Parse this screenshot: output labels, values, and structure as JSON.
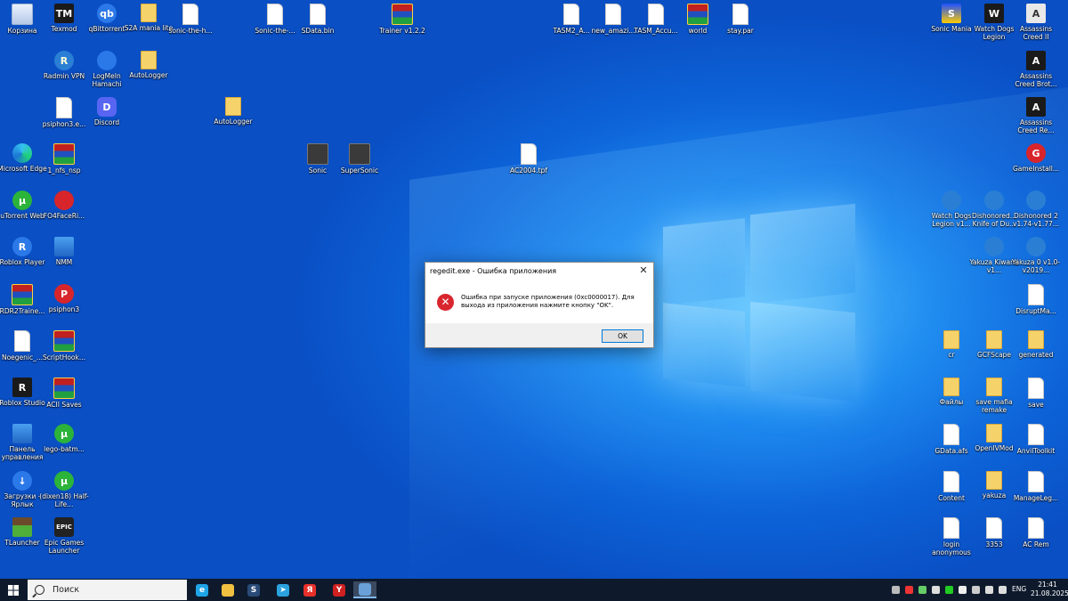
{
  "desktop_icons": [
    {
      "id": "recycle",
      "label": "Корзина",
      "glyph": "",
      "type": "t-recycle"
    },
    {
      "id": "texmod",
      "label": "Texmod",
      "glyph": "TM",
      "type": "t-dark"
    },
    {
      "id": "qbit",
      "label": "qBittorrent",
      "glyph": "qb",
      "type": "t-blue"
    },
    {
      "id": "s2a",
      "label": "S2A mania lite",
      "glyph": "",
      "type": "t-folder"
    },
    {
      "id": "sonic1",
      "label": "sonic-the-h...",
      "glyph": "",
      "type": "t-file"
    },
    {
      "id": "sonic2",
      "label": "Sonic-the-...",
      "glyph": "",
      "type": "t-file"
    },
    {
      "id": "sdata",
      "label": "SData.bin",
      "glyph": "",
      "type": "t-file"
    },
    {
      "id": "trainer",
      "label": "Trainer v1.2.2",
      "glyph": "",
      "type": "t-rar"
    },
    {
      "id": "tasm2",
      "label": "TASM2_A...",
      "glyph": "",
      "type": "t-file"
    },
    {
      "id": "newamaz",
      "label": "new_amazi...",
      "glyph": "",
      "type": "t-file"
    },
    {
      "id": "tasmacc",
      "label": "TASM_Accu...",
      "glyph": "",
      "type": "t-file"
    },
    {
      "id": "world",
      "label": "world",
      "glyph": "",
      "type": "t-rar"
    },
    {
      "id": "staypar",
      "label": "stay.par",
      "glyph": "",
      "type": "t-file"
    },
    {
      "id": "sonicmania",
      "label": "Sonic Mania",
      "glyph": "S",
      "type": "t-sonic"
    },
    {
      "id": "wdl1",
      "label": "Watch Dogs Legion",
      "glyph": "W",
      "type": "t-dark"
    },
    {
      "id": "ac2",
      "label": "Assassins Creed II",
      "glyph": "A",
      "type": "t-ac"
    },
    {
      "id": "radmin",
      "label": "Radmin VPN",
      "glyph": "R",
      "type": "t-wrench"
    },
    {
      "id": "hamachi",
      "label": "LogMeIn Hamachi",
      "glyph": "",
      "type": "t-blue"
    },
    {
      "id": "autologger1",
      "label": "AutoLogger",
      "glyph": "",
      "type": "t-folder"
    },
    {
      "id": "acbrot",
      "label": "Assassins Creed Brot...",
      "glyph": "A",
      "type": "t-dark"
    },
    {
      "id": "psiphon1",
      "label": "psiphon3.e...",
      "glyph": "",
      "type": "t-file"
    },
    {
      "id": "discord",
      "label": "Discord",
      "glyph": "D",
      "type": "t-purple"
    },
    {
      "id": "autologger2",
      "label": "AutoLogger",
      "glyph": "",
      "type": "t-folder"
    },
    {
      "id": "acre",
      "label": "Assassins Creed Re...",
      "glyph": "A",
      "type": "t-dark"
    },
    {
      "id": "edge",
      "label": "Microsoft Edge",
      "glyph": "",
      "type": "t-edge"
    },
    {
      "id": "nfsnp",
      "label": "1_nfs_nsp",
      "glyph": "",
      "type": "t-rar"
    },
    {
      "id": "sonicg",
      "label": "Sonic",
      "glyph": "",
      "type": "t-game"
    },
    {
      "id": "supersonic",
      "label": "SuperSonic",
      "glyph": "",
      "type": "t-game"
    },
    {
      "id": "ac2004",
      "label": "AC2004.tpf",
      "glyph": "",
      "type": "t-file"
    },
    {
      "id": "gameinstall",
      "label": "GameInstall...",
      "glyph": "G",
      "type": "t-red"
    },
    {
      "id": "utweb",
      "label": "uTorrent Web",
      "glyph": "µ",
      "type": "t-green"
    },
    {
      "id": "fo4face",
      "label": "FO4FaceRi...",
      "glyph": "",
      "type": "t-red"
    },
    {
      "id": "wdl2",
      "label": "Watch Dogs Legion v1...",
      "glyph": "",
      "type": "t-wrench"
    },
    {
      "id": "dishonored1",
      "label": "Dishonored... Knife of Du...",
      "glyph": "",
      "type": "t-wrench"
    },
    {
      "id": "dishonored2",
      "label": "Dishonored 2 v1.74-v1.77...",
      "glyph": "",
      "type": "t-wrench"
    },
    {
      "id": "roblox",
      "label": "Roblox Player",
      "glyph": "R",
      "type": "t-blue"
    },
    {
      "id": "nmm",
      "label": "NMM",
      "glyph": "",
      "type": "t-pc"
    },
    {
      "id": "yakuzak",
      "label": "Yakuza Kiwami v1...",
      "glyph": "",
      "type": "t-wrench"
    },
    {
      "id": "yakuza0",
      "label": "Yakuza 0 v1.0-v2019...",
      "glyph": "",
      "type": "t-wrench"
    },
    {
      "id": "rdr2",
      "label": "RDR2Traine...",
      "glyph": "",
      "type": "t-rar"
    },
    {
      "id": "psiphon2",
      "label": "psiphon3",
      "glyph": "P",
      "type": "t-red"
    },
    {
      "id": "disruptma",
      "label": "DisruptMa...",
      "glyph": "",
      "type": "t-file"
    },
    {
      "id": "noegenic",
      "label": "Noegenic_...",
      "glyph": "",
      "type": "t-file"
    },
    {
      "id": "scripthook",
      "label": "ScriptHook...",
      "glyph": "",
      "type": "t-rar"
    },
    {
      "id": "cr",
      "label": "cr",
      "glyph": "",
      "type": "t-folder"
    },
    {
      "id": "gcfscape",
      "label": "GCFScape",
      "glyph": "",
      "type": "t-folder"
    },
    {
      "id": "generated",
      "label": "generated",
      "glyph": "",
      "type": "t-folder"
    },
    {
      "id": "robloxstudio",
      "label": "Roblox Studio",
      "glyph": "R",
      "type": "t-dark"
    },
    {
      "id": "aciisaves",
      "label": "ACII Saves",
      "glyph": "",
      "type": "t-rar"
    },
    {
      "id": "files",
      "label": "Файлы",
      "glyph": "",
      "type": "t-folder"
    },
    {
      "id": "savemafia",
      "label": "save mafia remake",
      "glyph": "",
      "type": "t-folder"
    },
    {
      "id": "save",
      "label": "save",
      "glyph": "",
      "type": "t-file"
    },
    {
      "id": "controlpanel",
      "label": "Панель управления",
      "glyph": "",
      "type": "t-pc"
    },
    {
      "id": "legobatman",
      "label": "lego-batm...",
      "glyph": "µ",
      "type": "t-green"
    },
    {
      "id": "gdata",
      "label": "GData.afs",
      "glyph": "",
      "type": "t-file"
    },
    {
      "id": "openiv",
      "label": "OpenIVMod",
      "glyph": "",
      "type": "t-folder"
    },
    {
      "id": "anvil",
      "label": "AnvilToolkit",
      "glyph": "",
      "type": "t-file"
    },
    {
      "id": "downloads",
      "label": "Загрузки - Ярлык",
      "glyph": "↓",
      "type": "t-blue"
    },
    {
      "id": "halflife",
      "label": "(dixen18) Half-Life...",
      "glyph": "µ",
      "type": "t-green"
    },
    {
      "id": "content",
      "label": "Content",
      "glyph": "",
      "type": "t-file"
    },
    {
      "id": "yakuzaf",
      "label": "yakuza",
      "glyph": "",
      "type": "t-folder"
    },
    {
      "id": "manageleg",
      "label": "ManageLeg...",
      "glyph": "",
      "type": "t-file"
    },
    {
      "id": "tlauncher",
      "label": "TLauncher",
      "glyph": "",
      "type": "t-mc"
    },
    {
      "id": "epic",
      "label": "Epic Games Launcher",
      "glyph": "EPIC",
      "type": "t-epic"
    },
    {
      "id": "loginanon",
      "label": "login anonymous",
      "glyph": "",
      "type": "t-file"
    },
    {
      "id": "f3353",
      "label": "3353",
      "glyph": "",
      "type": "t-file"
    },
    {
      "id": "acrem",
      "label": "AC Rem",
      "glyph": "",
      "type": "t-file"
    }
  ],
  "dialog": {
    "title": "regedit.exe - Ошибка приложения",
    "close_glyph": "✕",
    "error_glyph": "✕",
    "message": "Ошибка при запуске приложения (0xc0000017). Для выхода из приложения нажмите кнопку \"OK\".",
    "ok_label": "OK"
  },
  "taskbar": {
    "search_placeholder": "Поиск",
    "apps": [
      {
        "id": "edge",
        "glyph": "e",
        "color": "#1fa4e6"
      },
      {
        "id": "explorer",
        "glyph": "",
        "color": "#f0c040"
      },
      {
        "id": "steam",
        "glyph": "S",
        "color": "#2a4a78"
      },
      {
        "id": "telegram",
        "glyph": "➤",
        "color": "#2aa3e0"
      },
      {
        "id": "yandex",
        "glyph": "Я",
        "color": "#e8302a"
      },
      {
        "id": "yandex-browser",
        "glyph": "Y",
        "color": "#d02020"
      },
      {
        "id": "regedit",
        "glyph": "",
        "color": "#6aa0d8"
      }
    ],
    "language": "ENG",
    "time": "21:41",
    "date": "21.08.2025"
  },
  "colors": {
    "accent": "#0078d7",
    "error": "#d9262e",
    "taskbar": "#0e1a2c"
  }
}
